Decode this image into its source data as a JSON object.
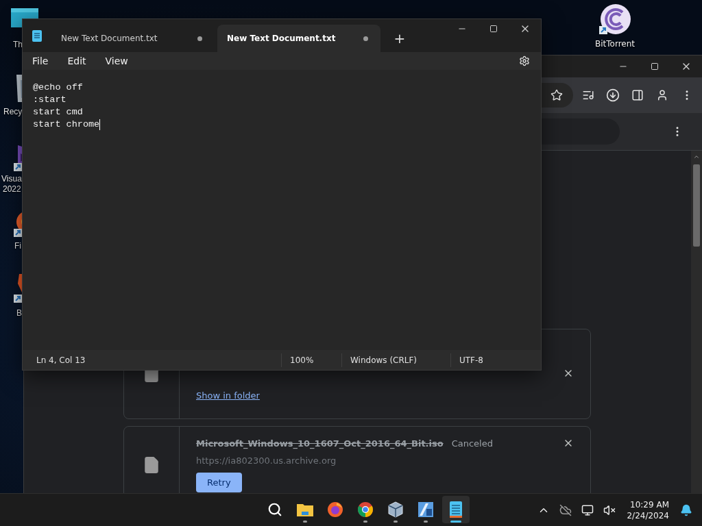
{
  "desktop": {
    "icons": [
      {
        "kind": "monitor",
        "lines": [
          "Th"
        ]
      },
      {
        "kind": "recycle",
        "lines": [
          "Recy"
        ]
      },
      {
        "kind": "studio",
        "lines": [
          "Visua",
          "2022"
        ]
      },
      {
        "kind": "firefox",
        "lines": [
          "Fi"
        ]
      },
      {
        "kind": "brave",
        "lines": [
          "B"
        ]
      },
      {
        "kind": "torrent",
        "lines": [
          "BitTorrent"
        ]
      }
    ]
  },
  "browser": {
    "downloads": [
      {
        "kind": "completed",
        "link": "Show in folder"
      },
      {
        "kind": "canceled",
        "file_name": "Microsoft_Windows_10_1607_Oct_2016_64_Bit.iso",
        "status": "Canceled",
        "url": "https://ia802300.us.archive.org",
        "button": "Retry"
      }
    ]
  },
  "notepad": {
    "tabs": [
      {
        "label": "New Text Document.txt",
        "selected": false,
        "modified": true
      },
      {
        "label": "New Text Document.txt",
        "selected": true,
        "modified": true
      }
    ],
    "new_tab": "+",
    "menu": [
      "File",
      "Edit",
      "View"
    ],
    "lines": [
      "@echo off",
      ":start",
      "start cmd",
      "start chrome"
    ],
    "status": {
      "position": "Ln 4, Col 13",
      "zoom": "100%",
      "line_ending": "Windows (CRLF)",
      "encoding": "UTF-8"
    }
  },
  "taskbar": {
    "apps": [
      {
        "kind": "search",
        "running": false,
        "active": false
      },
      {
        "kind": "explorer",
        "running": true,
        "active": false
      },
      {
        "kind": "firefox",
        "running": false,
        "active": false
      },
      {
        "kind": "chrome",
        "running": true,
        "active": false
      },
      {
        "kind": "virtualbox",
        "running": true,
        "active": false
      },
      {
        "kind": "tool",
        "running": true,
        "active": false
      },
      {
        "kind": "notepad",
        "running": true,
        "active": true
      }
    ],
    "time": "10:29 AM",
    "date": "2/24/2024"
  }
}
